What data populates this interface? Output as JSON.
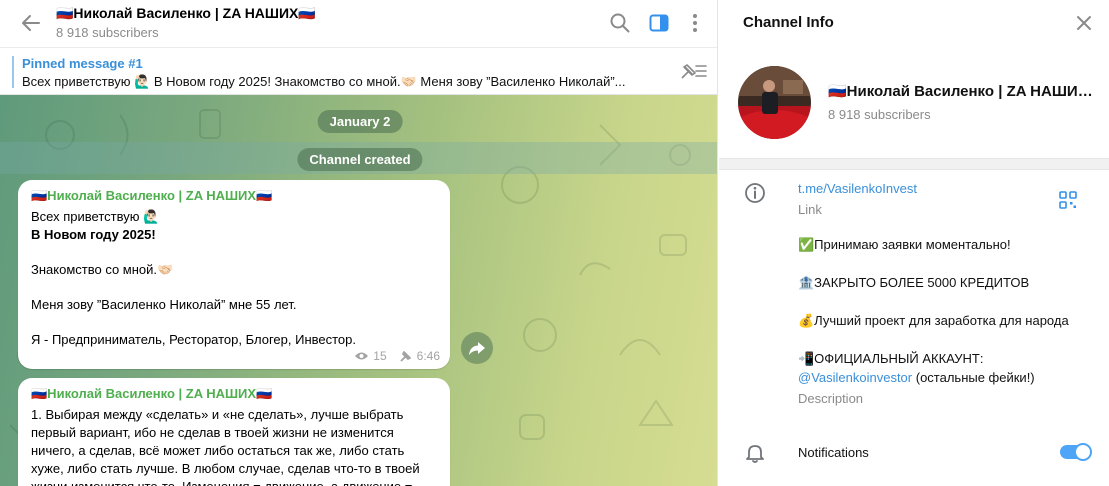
{
  "chat": {
    "title": "🇷🇺Николай Василенко | ZA НАШИХ🇷🇺",
    "subscribers": "8 918 subscribers",
    "pinned": {
      "title": "Pinned message #1",
      "text": "Всех приветствую 🙋🏻‍♂️  В Новом году 2025!  Знакомство со мной.🤝🏻  Меня зову ”Василенко Николай”..."
    },
    "date_pill": "January 2",
    "service_pill": "Channel created",
    "messages": [
      {
        "author": "🇷🇺Николай Василенко | ZA НАШИХ🇷🇺",
        "lines": [
          "Всех приветствую 🙋🏻‍♂️",
          "В Новом году 2025!",
          "Знакомство со мной.🤝🏻",
          "Меня зову ”Василенко Николай” мне 55 лет.",
          "Я - Предприниматель, Ресторатор, Блогер, Инвестор."
        ],
        "views": "15",
        "time": "6:46"
      },
      {
        "author": "🇷🇺Николай Василенко | ZA НАШИХ🇷🇺",
        "lines": [
          "1. Выбирая между «сделать» и «не сделать», лучше выбрать",
          "первый вариант, ибо не сделав в твоей жизни не изменится",
          "ничего, а сделав, всё может либо остаться так же, либо стать",
          "хуже, либо стать лучше. В любом случае, сделав что-то в твоей",
          "жизни изменится что-то. Изменения = движение, а движение ="
        ]
      }
    ]
  },
  "info": {
    "title": "Channel Info",
    "name": "🇷🇺Николай Василенко | ZA НАШИХ🇷🇺",
    "subscribers": "8 918 subscribers",
    "link": "t.me/VasilenkoInvest",
    "link_caption": "Link",
    "description": {
      "line1": "✅Принимаю заявки моментально!",
      "line2": "🏦ЗАКРЫТО БОЛЕЕ 5000 КРЕДИТОВ",
      "line3": "💰Лучший проект для заработка для народа",
      "line4": "📲ОФИЦИАЛЬНЫЙ АККАУНТ:",
      "handle": "@Vasilenkoinvestor",
      "handle_suffix": " (остальные фейки!)"
    },
    "description_caption": "Description",
    "notifications_label": "Notifications",
    "notifications_on": true
  },
  "colors": {
    "accent": "#3390ec",
    "author_green": "#4fae4e",
    "toggle": "#4ea4f6"
  },
  "icons": [
    "back-arrow-icon",
    "search-icon",
    "sidebar-toggle-icon",
    "more-vertical-icon",
    "unpin-icon",
    "forward-icon",
    "close-icon",
    "info-icon",
    "qr-code-icon",
    "bell-icon",
    "eye-icon",
    "pin-icon"
  ]
}
